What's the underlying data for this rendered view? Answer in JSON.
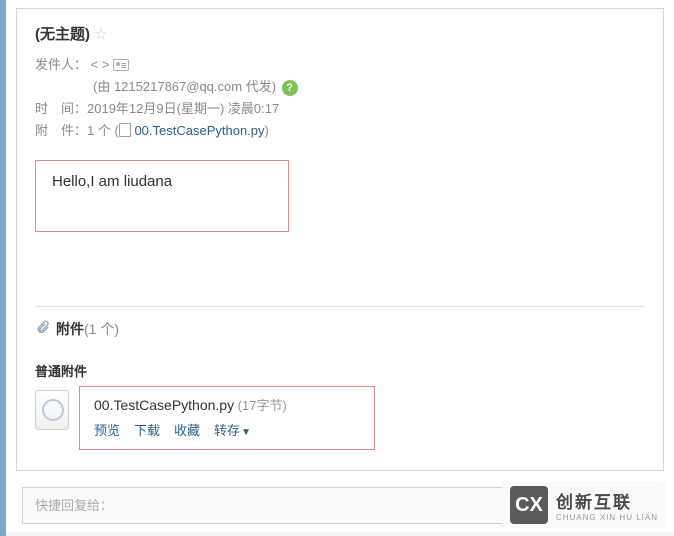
{
  "subject": "(无主题)",
  "meta": {
    "from_label": "发件人：",
    "from_value": "< >",
    "behalf_prefix": "(由 ",
    "behalf_email": "1215217867@qq.com",
    "behalf_suffix": " 代发)",
    "time_label": "时　间：",
    "time_value": "2019年12月9日(星期一) 凌晨0:17",
    "attach_label": "附　件：",
    "attach_count_text": "1 个",
    "attach_filename_link": "00.TestCasePython.py"
  },
  "body": "Hello,I am liudana",
  "attachments": {
    "section_title": "附件",
    "section_count": "(1 个)",
    "sub_title": "普通附件",
    "file": {
      "name": "00.TestCasePython.py",
      "size": "(17字节)"
    },
    "actions": {
      "preview": "预览",
      "download": "下载",
      "favorite": "收藏",
      "forward": "转存"
    }
  },
  "reply_placeholder": "快捷回复给：",
  "watermark": {
    "main": "创新互联",
    "sub": "CHUANG XIN HU LIAN",
    "logo": "CX"
  }
}
